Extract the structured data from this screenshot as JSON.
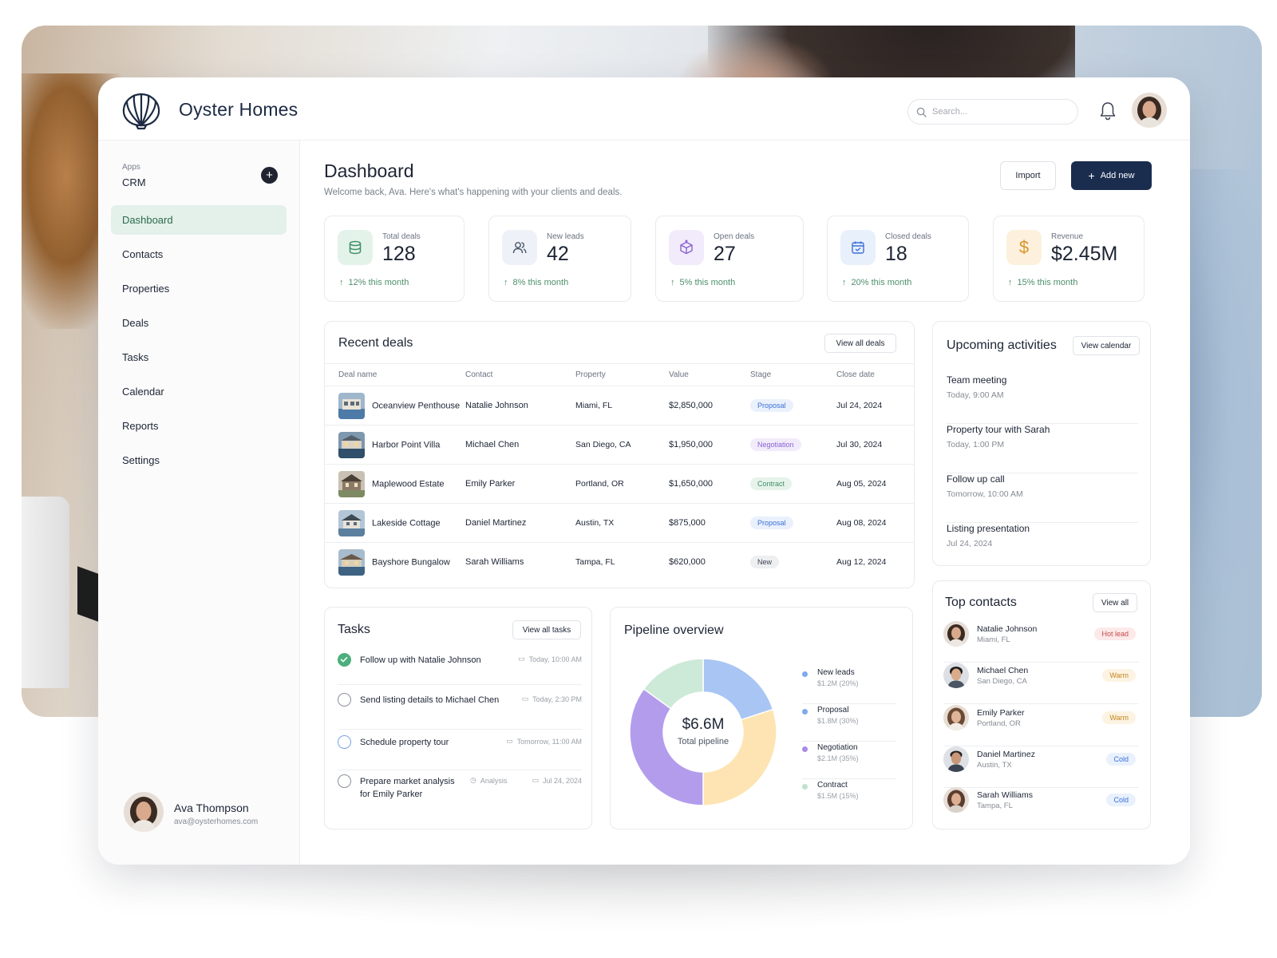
{
  "brand": {
    "name": "Oyster Homes"
  },
  "search": {
    "placeholder": "Search..."
  },
  "sidebar": {
    "apps_label": "Apps",
    "apps_value": "CRM",
    "items": [
      {
        "label": "Dashboard",
        "active": true
      },
      {
        "label": "Contacts"
      },
      {
        "label": "Properties"
      },
      {
        "label": "Deals"
      },
      {
        "label": "Tasks"
      },
      {
        "label": "Calendar"
      },
      {
        "label": "Reports"
      },
      {
        "label": "Settings"
      }
    ],
    "profile": {
      "name": "Ava Thompson",
      "email": "ava@oysterhomes.com"
    }
  },
  "header": {
    "title": "Dashboard",
    "subtitle": "Welcome back, Ava. Here's what's happening with your clients and deals.",
    "import_label": "Import",
    "add_label": "Add new"
  },
  "stats": [
    {
      "label": "Total deals",
      "value": "128",
      "change": "12% this month",
      "icon": "database-icon",
      "color": "#e4f3ea"
    },
    {
      "label": "New leads",
      "value": "42",
      "change": "8% this month",
      "icon": "users-icon",
      "color": "#eef2f8"
    },
    {
      "label": "Open deals",
      "value": "27",
      "change": "5% this month",
      "icon": "box-icon",
      "color": "#f1ebfb"
    },
    {
      "label": "Closed deals",
      "value": "18",
      "change": "20% this month",
      "icon": "calendar-check-icon",
      "color": "#e8f0fc"
    },
    {
      "label": "Revenue",
      "value": "$2.45M",
      "change": "15% this month",
      "icon": "dollar-icon",
      "color": "#fdf1dd"
    }
  ],
  "recent_deals": {
    "title": "Recent deals",
    "view_all": "View all deals",
    "columns": [
      "Deal name",
      "Contact",
      "Property",
      "Value",
      "Stage",
      "Close date"
    ],
    "rows": [
      {
        "name": "Oceanview Penthouse",
        "contact": "Natalie Johnson",
        "property": "Miami, FL",
        "value": "$2,850,000",
        "stage": "Proposal",
        "date": "Jul 24, 2024"
      },
      {
        "name": "Harbor Point Villa",
        "contact": "Michael Chen",
        "property": "San Diego, CA",
        "value": "$1,950,000",
        "stage": "Negotiation",
        "date": "Jul 30, 2024"
      },
      {
        "name": "Maplewood Estate",
        "contact": "Emily Parker",
        "property": "Portland, OR",
        "value": "$1,650,000",
        "stage": "Contract",
        "date": "Aug 05, 2024"
      },
      {
        "name": "Lakeside Cottage",
        "contact": "Daniel Martinez",
        "property": "Austin, TX",
        "value": "$875,000",
        "stage": "Proposal",
        "date": "Aug 08, 2024"
      },
      {
        "name": "Bayshore Bungalow",
        "contact": "Sarah Williams",
        "property": "Tampa, FL",
        "value": "$620,000",
        "stage": "New",
        "date": "Aug 12, 2024"
      }
    ]
  },
  "activities": {
    "title": "Upcoming activities",
    "view_all": "View calendar",
    "items": [
      {
        "title": "Team meeting",
        "time": "Today, 9:00 AM"
      },
      {
        "title": "Property tour with Sarah",
        "time": "Today, 1:00 PM"
      },
      {
        "title": "Follow up call",
        "time": "Tomorrow, 10:00 AM"
      },
      {
        "title": "Listing presentation",
        "time": "Jul 24, 2024"
      }
    ]
  },
  "contacts": {
    "title": "Top contacts",
    "view_all": "View all",
    "items": [
      {
        "name": "Natalie Johnson",
        "location": "Miami, FL",
        "badge": "Hot lead"
      },
      {
        "name": "Michael Chen",
        "location": "San Diego, CA",
        "badge": "Warm"
      },
      {
        "name": "Emily Parker",
        "location": "Portland, OR",
        "badge": "Warm"
      },
      {
        "name": "Daniel Martinez",
        "location": "Austin, TX",
        "badge": "Cold"
      },
      {
        "name": "Sarah Williams",
        "location": "Tampa, FL",
        "badge": "Cold"
      }
    ]
  },
  "tasks": {
    "title": "Tasks",
    "view_all": "View all tasks",
    "items": [
      {
        "text": "Follow up with Natalie Johnson",
        "due": "Today, 10:00 AM",
        "done": true
      },
      {
        "text": "Send listing details to Michael Chen",
        "due": "Today, 2:30 PM",
        "done": false
      },
      {
        "text": "Schedule property tour",
        "due": "Tomorrow, 11:00 AM",
        "done": false
      },
      {
        "text": "Prepare market analysis for Emily Parker",
        "tag": "Analysis",
        "due": "Jul 24, 2024",
        "done": false
      }
    ]
  },
  "pipeline": {
    "title": "Pipeline overview",
    "total": "$6.6M",
    "total_label": "Total pipeline"
  },
  "chart_data": {
    "type": "pie",
    "series": [
      {
        "name": "New leads",
        "label": "$1.2M (20%)",
        "value": 20,
        "color": "#a8c5f3"
      },
      {
        "name": "Proposal",
        "label": "$1.8M (30%)",
        "value": 30,
        "color": "#fde4b2"
      },
      {
        "name": "Negotiation",
        "label": "$2.1M (35%)",
        "value": 35,
        "color": "#b39cec"
      },
      {
        "name": "Contract",
        "label": "$1.5M (15%)",
        "value": 15,
        "color": "#cde9d8"
      }
    ]
  },
  "colors": {
    "accent": "#1b2d4f",
    "active_nav_bg": "#e4f0ea",
    "positive": "#4e8f6b"
  }
}
